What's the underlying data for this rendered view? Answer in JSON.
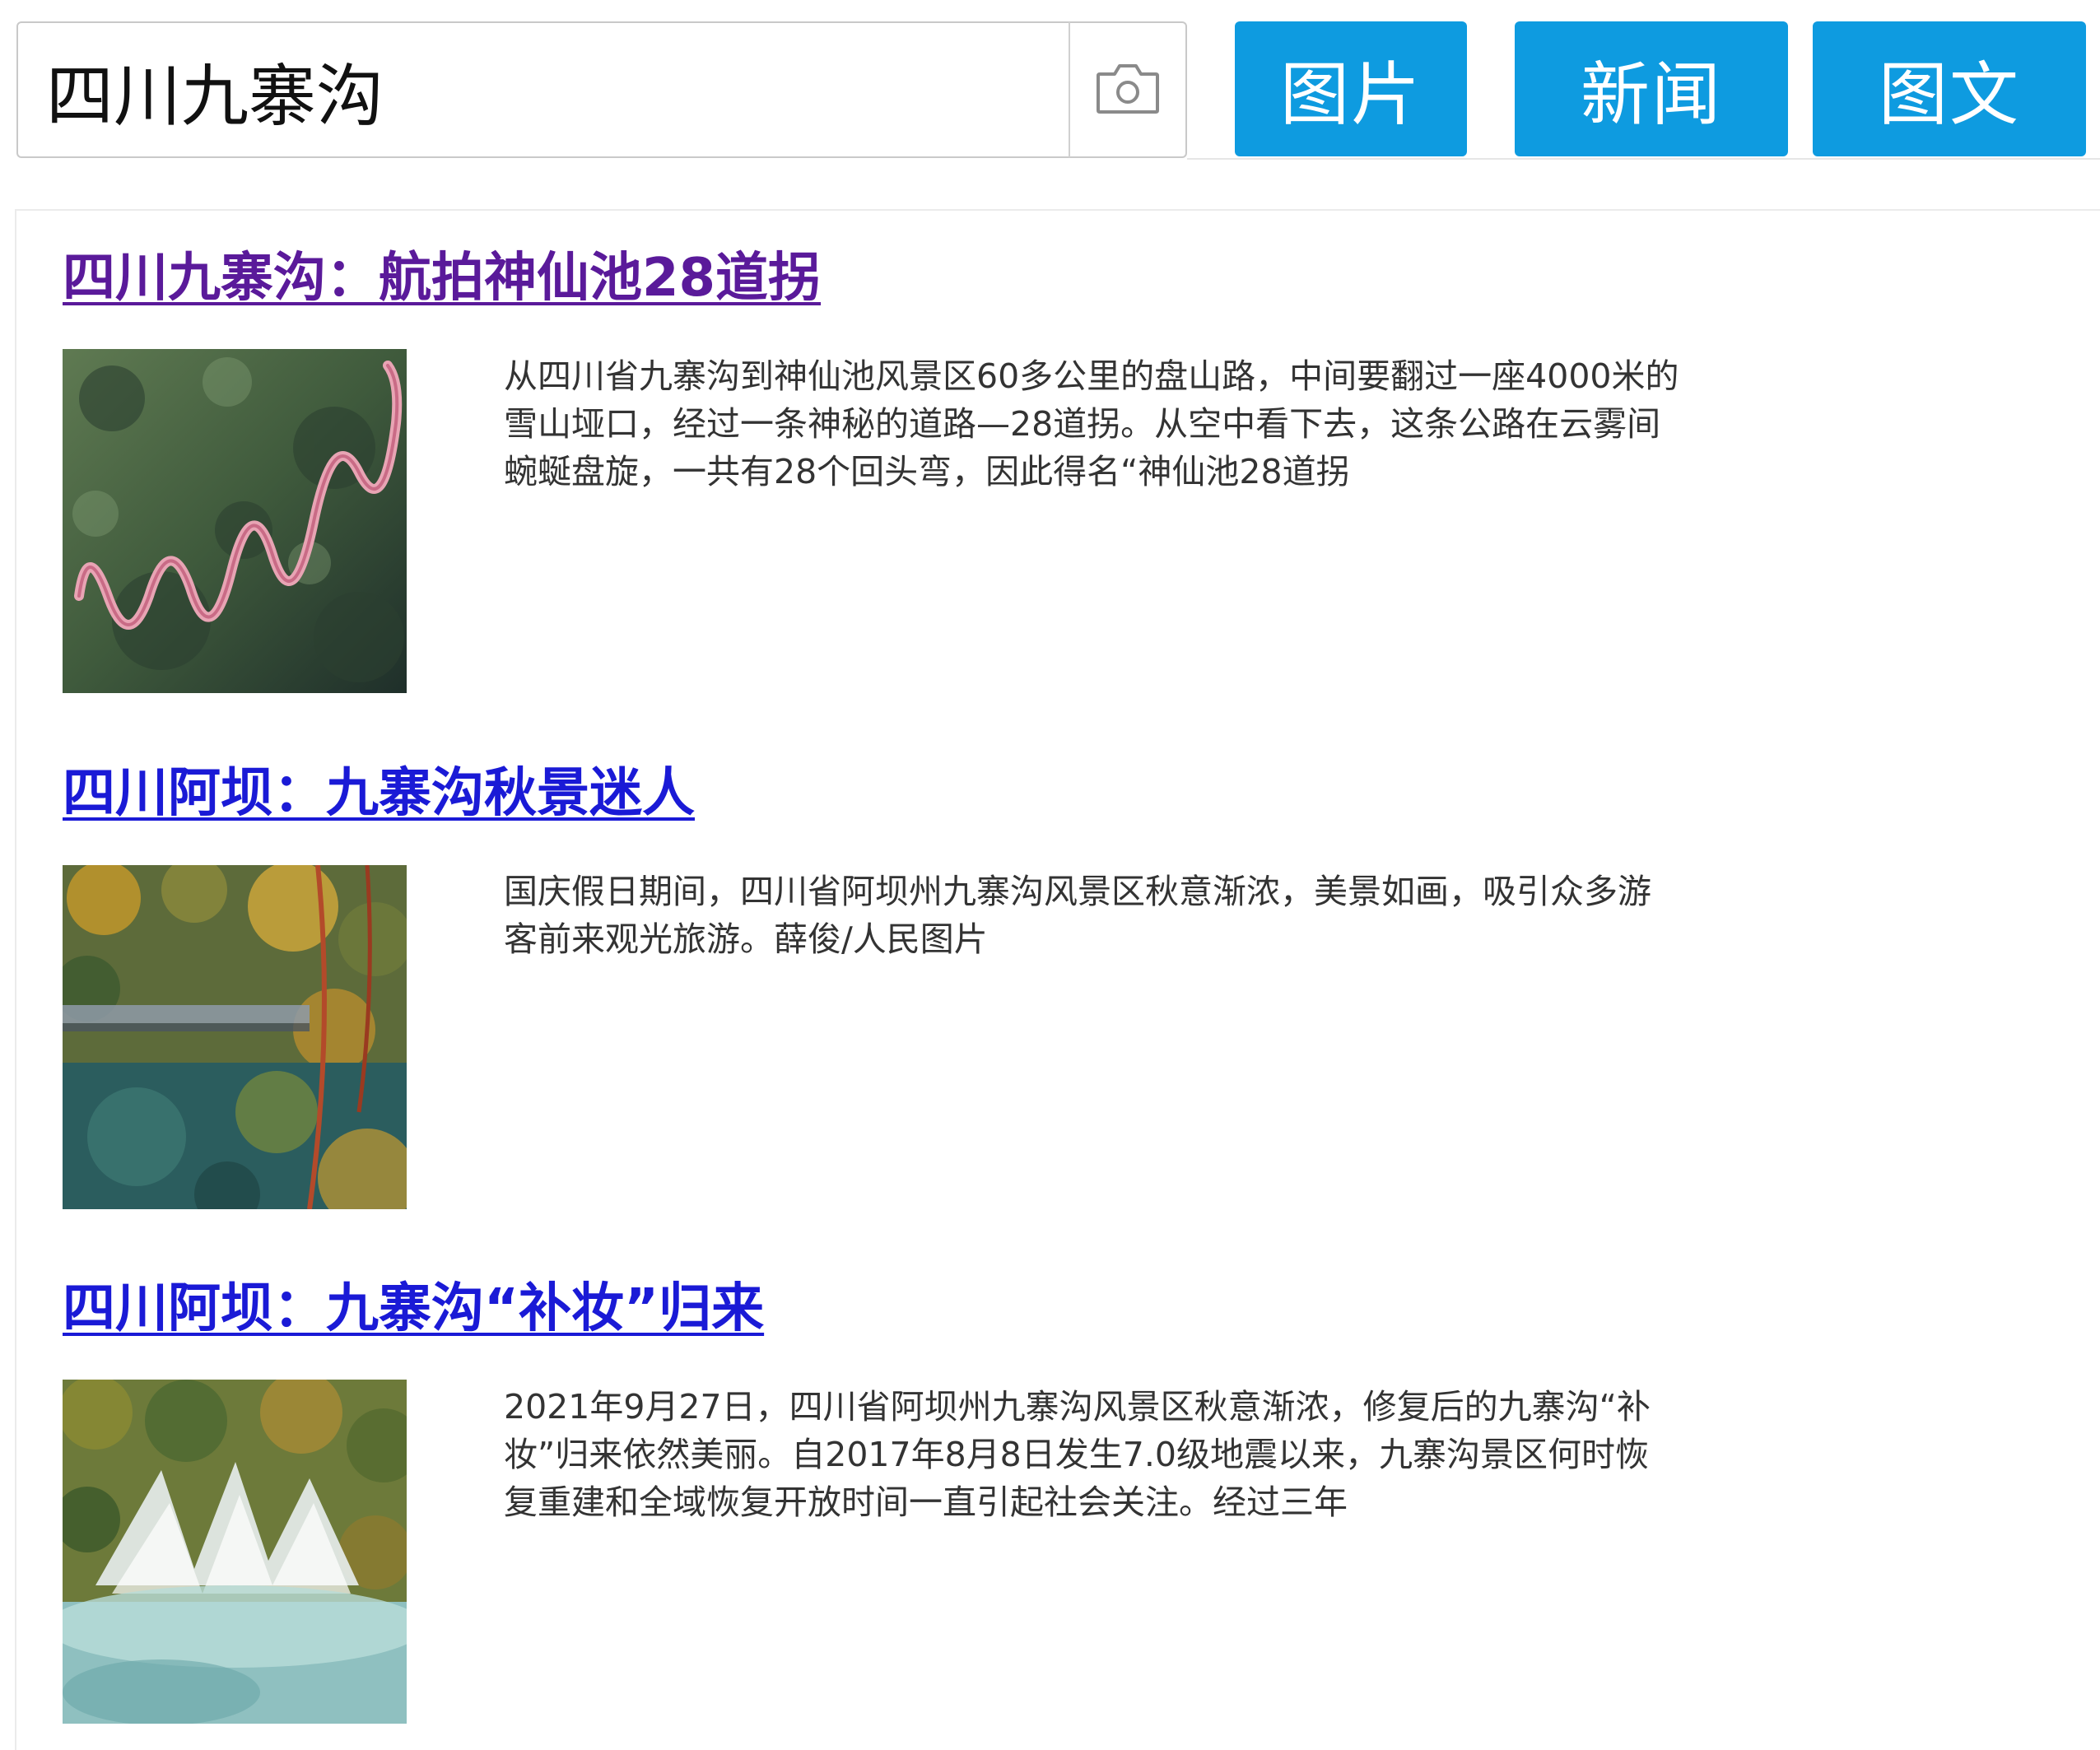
{
  "search": {
    "query": "四川九寨沟",
    "camera_icon": "camera-icon"
  },
  "tabs": {
    "images": "图片",
    "news": "新闻",
    "image_text": "图文"
  },
  "colors": {
    "tab_background": "#0e9be0",
    "tab_text": "#ffffff",
    "visited_link": "#5a1a9a",
    "link": "#1a1ad6",
    "snippet_text": "#333333"
  },
  "results": [
    {
      "title": "四川九寨沟：航拍神仙池28道拐",
      "visited": true,
      "snippet": "从四川省九寨沟到神仙池风景区60多公里的盘山路，中间要翻过一座4000米的雪山垭口，经过一条神秘的道路—28道拐。从空中看下去，这条公路在云雾间蜿蜒盘旋，一共有28个回头弯，因此得名“神仙池28道拐"
    },
    {
      "title": "四川阿坝：九寨沟秋景迷人",
      "visited": false,
      "snippet": "国庆假日期间，四川省阿坝州九寨沟风景区秋意渐浓，美景如画，吸引众多游客前来观光旅游。薛俊/人民图片"
    },
    {
      "title": "四川阿坝：九寨沟“补妆”归来",
      "visited": false,
      "snippet": "2021年9月27日，四川省阿坝州九寨沟风景区秋意渐浓，修复后的九寨沟“补妆”归来依然美丽。自2017年8月8日发生7.0级地震以来，九寨沟景区何时恢复重建和全域恢复开放时间一直引起社会关注。经过三年"
    }
  ]
}
